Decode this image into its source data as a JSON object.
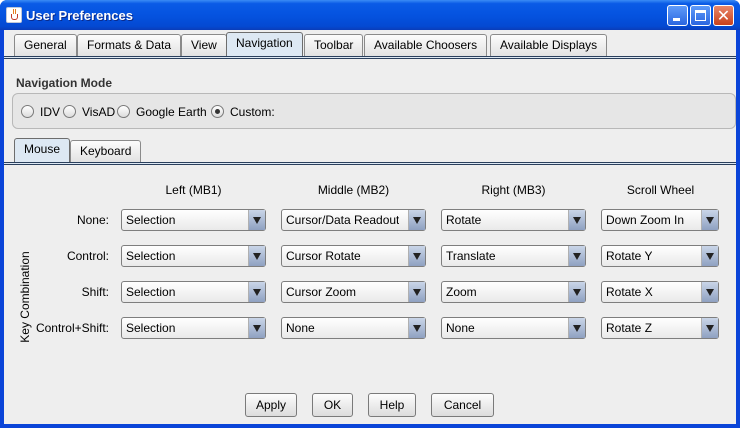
{
  "window": {
    "title": "User Preferences",
    "app_icon": "java-cup-icon",
    "controls": [
      "minimize-icon",
      "maximize-icon",
      "close-icon"
    ],
    "close_glyph": "✕"
  },
  "tabs": [
    {
      "label": "General"
    },
    {
      "label": "Formats & Data"
    },
    {
      "label": "View"
    },
    {
      "label": "Navigation",
      "active": true
    },
    {
      "label": "Toolbar"
    },
    {
      "label": "Available Choosers"
    },
    {
      "label": "Available Displays"
    }
  ],
  "navigation": {
    "heading": "Navigation Mode",
    "modes": [
      {
        "label": "IDV",
        "selected": false
      },
      {
        "label": "VisAD",
        "selected": false
      },
      {
        "label": "Google Earth",
        "selected": false
      },
      {
        "label": "Custom:",
        "selected": true
      }
    ]
  },
  "subtabs": [
    {
      "label": "Mouse",
      "active": true
    },
    {
      "label": "Keyboard"
    }
  ],
  "mouse": {
    "side_label": "Key Combination",
    "columns": [
      "Left (MB1)",
      "Middle (MB2)",
      "Right (MB3)",
      "Scroll Wheel"
    ],
    "rows": [
      {
        "label": "None:",
        "values": [
          "Selection",
          "Cursor/Data Readout",
          "Rotate",
          "Down Zoom In"
        ]
      },
      {
        "label": "Control:",
        "values": [
          "Selection",
          "Cursor Rotate",
          "Translate",
          "Rotate Y"
        ]
      },
      {
        "label": "Shift:",
        "values": [
          "Selection",
          "Cursor Zoom",
          "Zoom",
          "Rotate X"
        ]
      },
      {
        "label": "Control+Shift:",
        "values": [
          "Selection",
          "None",
          "None",
          "Rotate Z"
        ]
      }
    ]
  },
  "buttons": {
    "apply": "Apply",
    "ok": "OK",
    "help": "Help",
    "cancel": "Cancel"
  }
}
